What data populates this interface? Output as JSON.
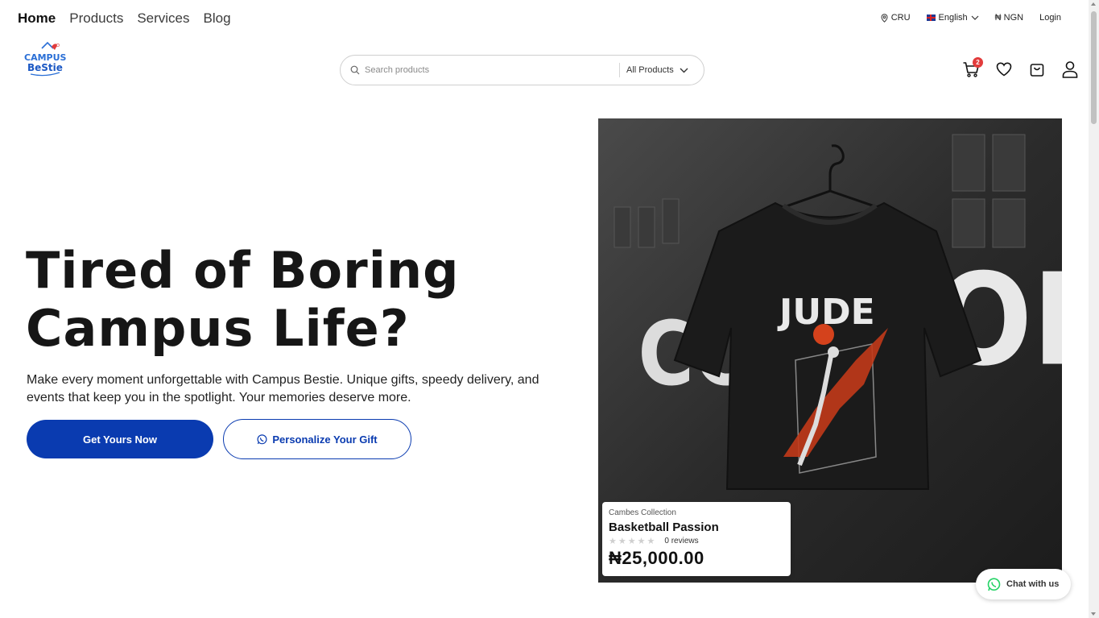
{
  "nav": {
    "links": [
      {
        "label": "Home",
        "active": true
      },
      {
        "label": "Products",
        "active": false
      },
      {
        "label": "Services",
        "active": false
      },
      {
        "label": "Blog",
        "active": false
      }
    ]
  },
  "utils": {
    "location": "CRU",
    "language": "English",
    "currency": "₦ NGN",
    "login": "Login"
  },
  "logo": {
    "line1": "CAMPUS",
    "line2": "BeStie"
  },
  "search": {
    "placeholder": "Search products",
    "category": "All Products"
  },
  "header_icons": {
    "cart_count": "2",
    "icons": [
      "cart-icon",
      "heart-icon",
      "shopping-bag-icon",
      "user-icon"
    ]
  },
  "hero": {
    "title_line1": "Tired of Boring",
    "title_line2": "Campus Life?",
    "subtitle": "Make every moment unforgettable with Campus Bestie. Unique gifts, speedy delivery, and events that keep you in the spotlight. Your memories deserve more.",
    "primary_button": "Get Yours Now",
    "secondary_button": "Personalize Your Gift"
  },
  "product_card": {
    "collection": "Cambes Collection",
    "name": "Basketball Passion",
    "reviews": "0 reviews",
    "price": "₦25,000.00",
    "rating": 0,
    "shirt_print": "JUDE"
  },
  "chat": {
    "label": "Chat with us"
  },
  "colors": {
    "primary": "#0a3bb0",
    "badge": "#e23b3b",
    "whatsapp": "#25d366"
  }
}
